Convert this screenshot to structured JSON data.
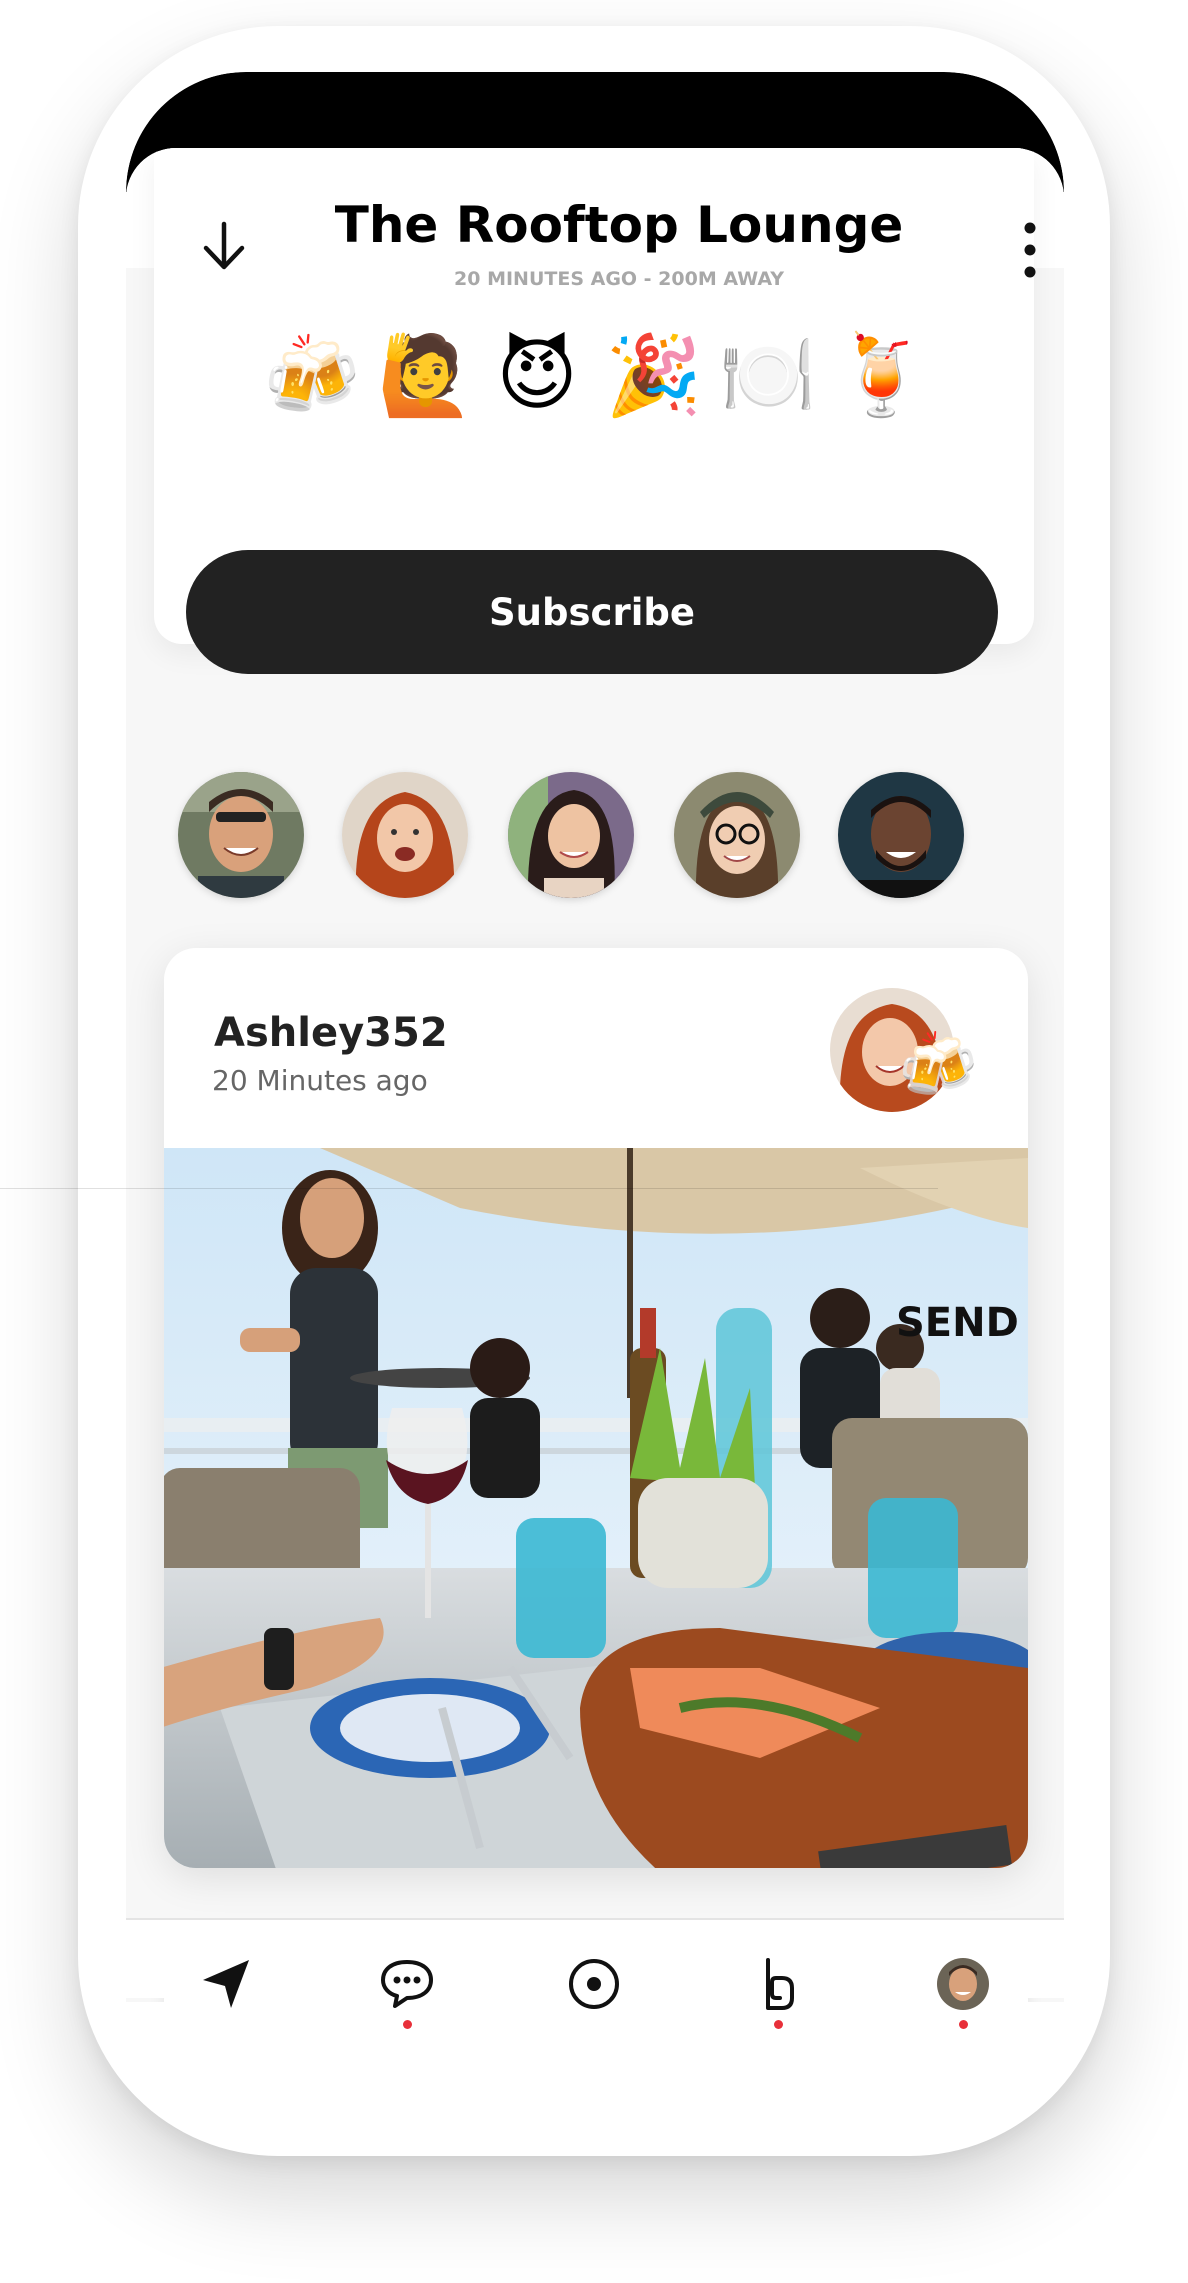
{
  "header": {
    "title": "The Rooftop Lounge",
    "meta": "20 MINUTES AGO  -  200M AWAY",
    "emojis": [
      "🍻",
      "🙋",
      "😈",
      "🎉",
      "🍽️",
      "🍹"
    ],
    "subscribe_label": "Subscribe"
  },
  "avatars": [
    {
      "name": "avatar-1"
    },
    {
      "name": "avatar-2"
    },
    {
      "name": "avatar-3"
    },
    {
      "name": "avatar-4"
    },
    {
      "name": "avatar-5"
    }
  ],
  "post": {
    "username": "Ashley352",
    "timestamp": "20 Minutes ago",
    "reaction_emoji": "🍻",
    "send_label": "SEND"
  },
  "tabbar": {
    "items": [
      {
        "icon": "navigation-arrow-icon",
        "has_dot": false
      },
      {
        "icon": "chat-bubble-icon",
        "has_dot": true
      },
      {
        "icon": "target-circle-icon",
        "has_dot": false
      },
      {
        "icon": "b-logo-icon",
        "has_dot": true
      },
      {
        "icon": "profile-avatar-icon",
        "has_dot": true
      }
    ]
  },
  "colors": {
    "accent_dot": "#e8303a",
    "button_bg": "#222222",
    "meta_text": "#a8a8a8"
  }
}
